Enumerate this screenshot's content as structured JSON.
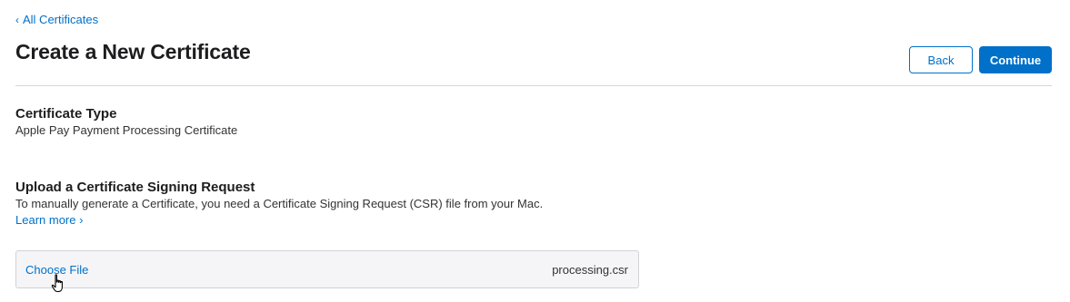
{
  "nav": {
    "back_link_chevron": "‹",
    "back_link_label": "All Certificates"
  },
  "header": {
    "title": "Create a New Certificate",
    "back_button": "Back",
    "continue_button": "Continue"
  },
  "certificate_type": {
    "heading": "Certificate Type",
    "value": "Apple Pay Payment Processing Certificate"
  },
  "upload": {
    "heading": "Upload a Certificate Signing Request",
    "description": "To manually generate a Certificate, you need a Certificate Signing Request (CSR) file from your Mac.",
    "learn_more": "Learn more ›",
    "choose_file_label": "Choose File",
    "file_name": "processing.csr"
  },
  "colors": {
    "accent": "#0070c9",
    "text": "#1d1d1f",
    "divider": "#d6d6d6",
    "file_box_bg": "#f5f5f7"
  },
  "icons": {
    "cursor": "hand-pointer-cursor-icon"
  }
}
